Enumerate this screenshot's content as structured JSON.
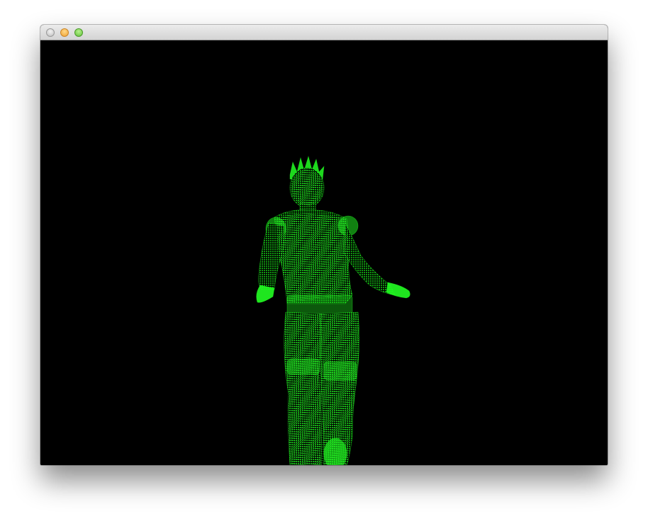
{
  "window": {
    "title": "",
    "controls": [
      "close",
      "minimize",
      "maximize"
    ]
  },
  "viewport": {
    "content": "point-cloud-human-figure",
    "background_color": "#000000",
    "point_color": "#00ff00"
  }
}
